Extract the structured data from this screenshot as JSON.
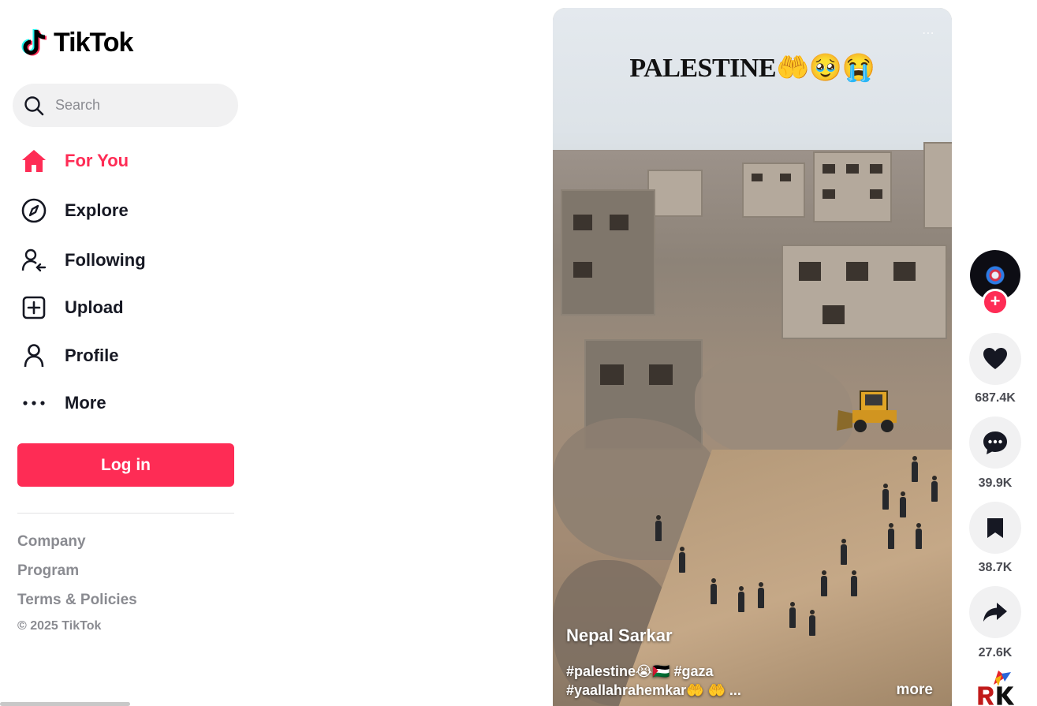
{
  "brand": {
    "name": "TikTok"
  },
  "search": {
    "placeholder": "Search"
  },
  "nav": {
    "items": [
      {
        "label": "For You",
        "icon": "home-icon",
        "active": true
      },
      {
        "label": "Explore",
        "icon": "compass-icon",
        "active": false
      },
      {
        "label": "Following",
        "icon": "following-icon",
        "active": false
      },
      {
        "label": "Upload",
        "icon": "upload-icon",
        "active": false
      },
      {
        "label": "Profile",
        "icon": "profile-icon",
        "active": false
      },
      {
        "label": "More",
        "icon": "more-dots-icon",
        "active": false
      }
    ]
  },
  "login": {
    "label": "Log in"
  },
  "footer": {
    "links": [
      "Company",
      "Program",
      "Terms & Policies"
    ],
    "copyright": "© 2025 TikTok"
  },
  "video": {
    "overlay_title": "PALESTINE🤲🥹😭",
    "more_glyph": "⋯",
    "author": "Nepal Sarkar",
    "caption_line1": "#palestine😭🇵🇸 #gaza",
    "caption_line2": "#yaallahrahemkar🤲 🤲 ...",
    "more_label": "more"
  },
  "actions": {
    "follow_glyph": "+",
    "likes": "687.4K",
    "comments": "39.9K",
    "saves": "38.7K",
    "shares": "27.6K"
  },
  "colors": {
    "accent": "#fe2c55",
    "text": "#161823",
    "muted": "#8a8b91",
    "action_bg": "#f1f1f2"
  }
}
